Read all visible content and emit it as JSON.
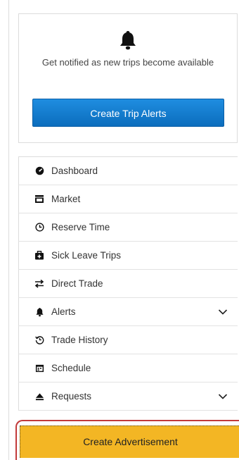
{
  "alert_card": {
    "message": "Get notified as new trips become available",
    "button_label": "Create Trip Alerts"
  },
  "menu": [
    {
      "label": "Dashboard",
      "icon": "dashboard-icon"
    },
    {
      "label": "Market",
      "icon": "store-icon"
    },
    {
      "label": "Reserve Time",
      "icon": "clock-icon"
    },
    {
      "label": "Sick Leave Trips",
      "icon": "medical-bag-icon"
    },
    {
      "label": "Direct Trade",
      "icon": "swap-icon"
    },
    {
      "label": "Alerts",
      "icon": "bell-icon",
      "expandable": true
    },
    {
      "label": "Trade History",
      "icon": "history-icon"
    },
    {
      "label": "Schedule",
      "icon": "calendar-icon"
    },
    {
      "label": "Requests",
      "icon": "eject-icon",
      "expandable": true
    }
  ],
  "advertisement": {
    "button_label": "Create Advertisement"
  },
  "colors": {
    "primary_button": "#1479cc",
    "ad_button": "#f3b624",
    "highlight_border": "#c23a3a"
  }
}
